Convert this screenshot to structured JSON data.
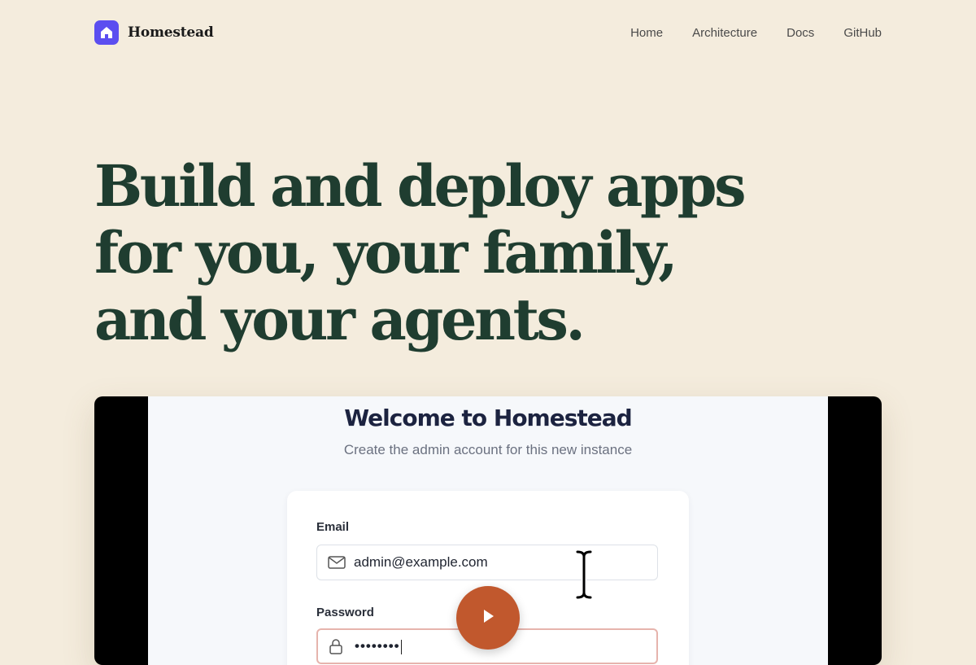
{
  "nav": {
    "brand": "Homestead",
    "links": [
      "Home",
      "Architecture",
      "Docs",
      "GitHub"
    ]
  },
  "hero": {
    "lines": [
      "Build and deploy apps",
      "for you, your family,",
      "and your agents."
    ]
  },
  "video": {
    "title": "Welcome to Homestead",
    "subtitle": "Create the admin account for this new instance",
    "email_label": "Email",
    "email_value": "admin@example.com",
    "password_label": "Password",
    "password_value": "••••••••"
  },
  "colors": {
    "background": "#f4ecdd",
    "brand_logo": "#5b4ef0",
    "heading": "#1f3d30",
    "play_button": "#c1582d"
  },
  "icons": [
    "house-icon",
    "mail-icon",
    "lock-icon",
    "play-icon",
    "text-cursor-icon"
  ]
}
